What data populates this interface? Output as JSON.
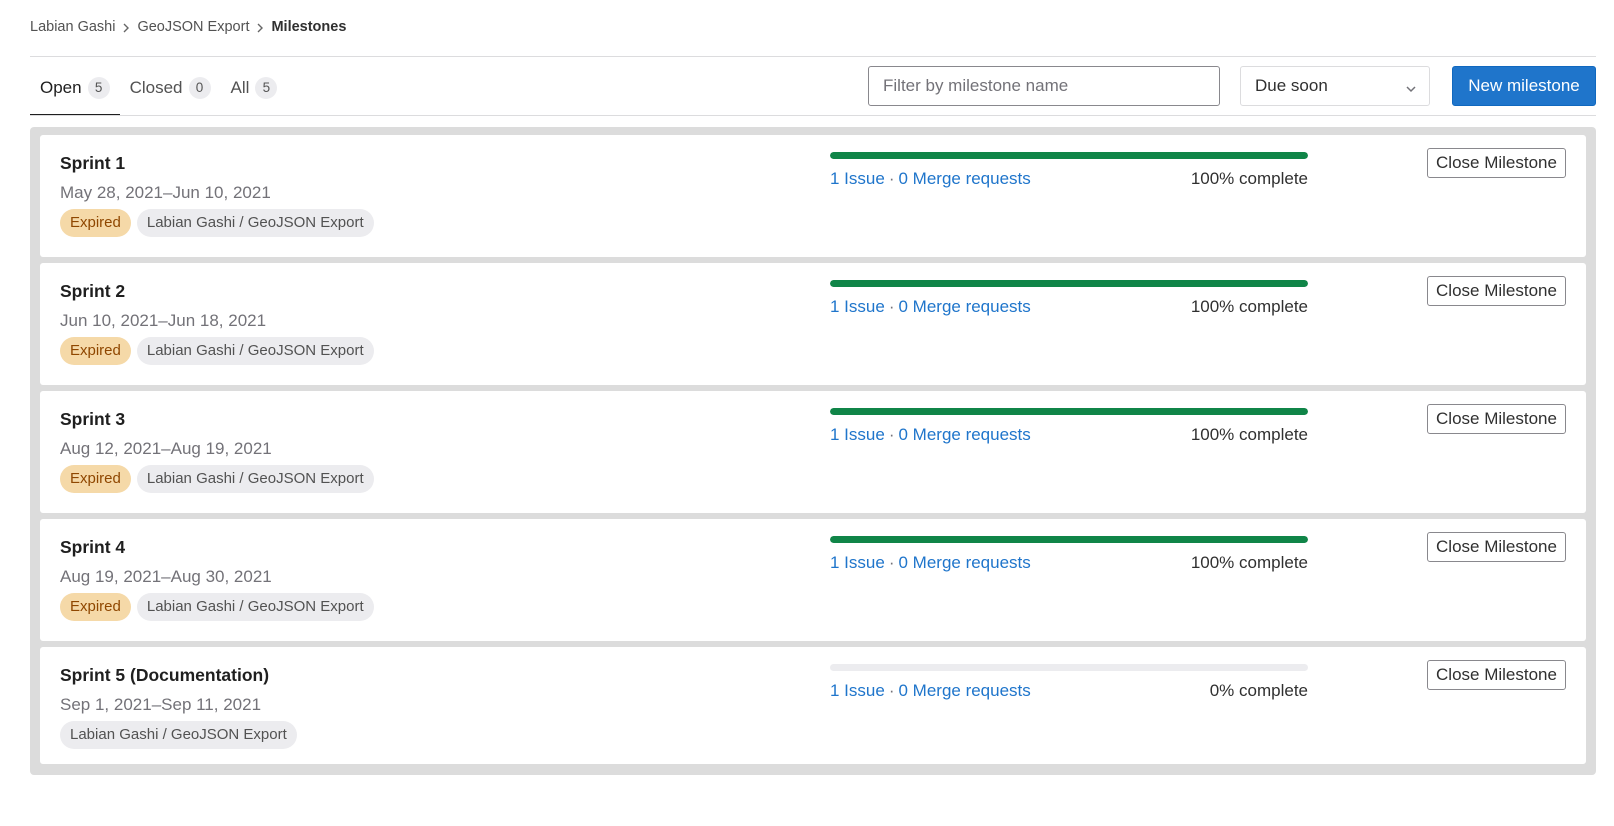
{
  "breadcrumb": {
    "items": [
      "Labian Gashi",
      "GeoJSON Export",
      "Milestones"
    ]
  },
  "tabs": [
    {
      "label": "Open",
      "count": "5"
    },
    {
      "label": "Closed",
      "count": "0"
    },
    {
      "label": "All",
      "count": "5"
    }
  ],
  "filter": {
    "placeholder": "Filter by milestone name"
  },
  "sort": {
    "selected": "Due soon"
  },
  "new_button": {
    "label": "New milestone"
  },
  "colors": {
    "primary": "#1f75cb",
    "success": "#108548",
    "expired_bg": "#f5d9a8"
  },
  "milestones": [
    {
      "title": "Sprint 1",
      "dates": "May 28, 2021–Jun 10, 2021",
      "expired": "Expired",
      "project": "Labian Gashi / GeoJSON Export",
      "issues": "1 Issue",
      "merge_requests": "0 Merge requests",
      "complete": "100% complete",
      "progress_percent": 100,
      "close_label": "Close Milestone"
    },
    {
      "title": "Sprint 2",
      "dates": "Jun 10, 2021–Jun 18, 2021",
      "expired": "Expired",
      "project": "Labian Gashi / GeoJSON Export",
      "issues": "1 Issue",
      "merge_requests": "0 Merge requests",
      "complete": "100% complete",
      "progress_percent": 100,
      "close_label": "Close Milestone"
    },
    {
      "title": "Sprint 3",
      "dates": "Aug 12, 2021–Aug 19, 2021",
      "expired": "Expired",
      "project": "Labian Gashi / GeoJSON Export",
      "issues": "1 Issue",
      "merge_requests": "0 Merge requests",
      "complete": "100% complete",
      "progress_percent": 100,
      "close_label": "Close Milestone"
    },
    {
      "title": "Sprint 4",
      "dates": "Aug 19, 2021–Aug 30, 2021",
      "expired": "Expired",
      "project": "Labian Gashi / GeoJSON Export",
      "issues": "1 Issue",
      "merge_requests": "0 Merge requests",
      "complete": "100% complete",
      "progress_percent": 100,
      "close_label": "Close Milestone"
    },
    {
      "title": "Sprint 5 (Documentation)",
      "dates": "Sep 1, 2021–Sep 11, 2021",
      "expired": "",
      "project": "Labian Gashi / GeoJSON Export",
      "issues": "1 Issue",
      "merge_requests": "0 Merge requests",
      "complete": "0% complete",
      "progress_percent": 0,
      "close_label": "Close Milestone"
    }
  ]
}
